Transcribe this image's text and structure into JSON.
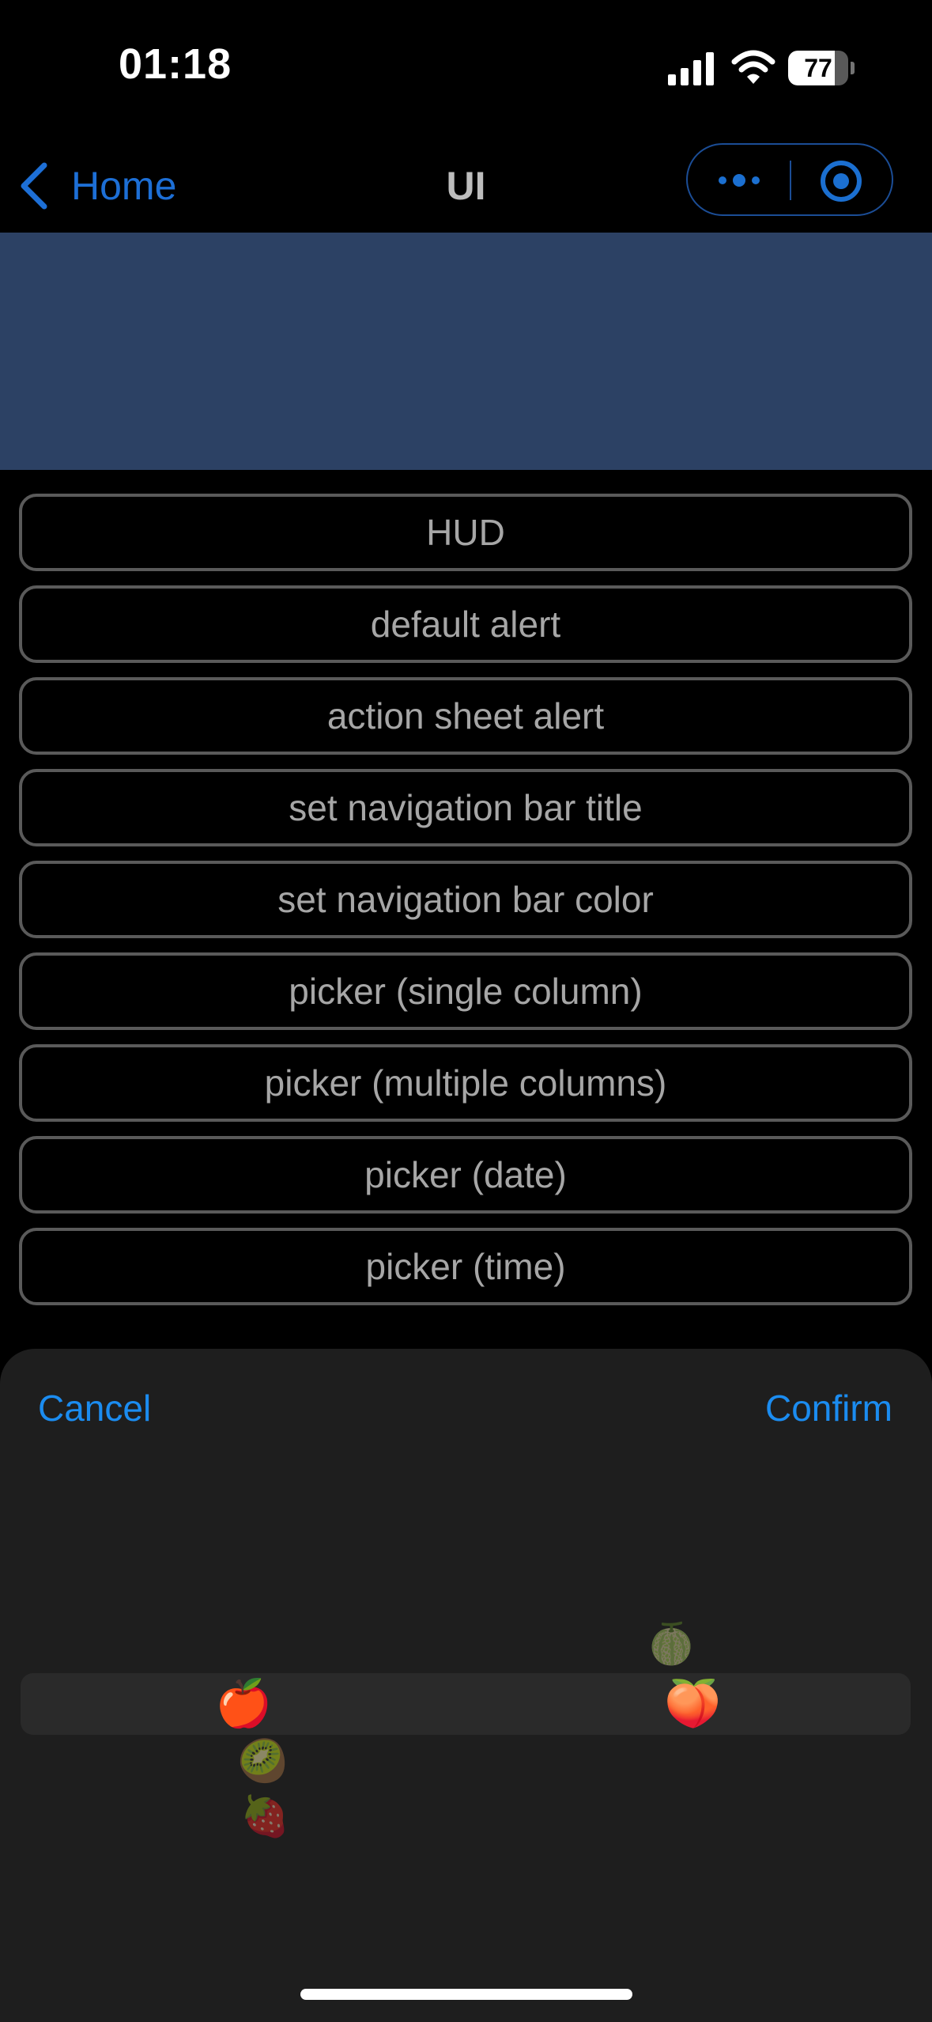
{
  "status_bar": {
    "time": "01:18",
    "battery_level": "77"
  },
  "nav": {
    "back_label": "Home",
    "title": "UI"
  },
  "buttons": [
    "HUD",
    "default alert",
    "action sheet alert",
    "set navigation bar title",
    "set navigation bar color",
    "picker (single column)",
    "picker (multiple columns)",
    "picker (date)",
    "picker (time)"
  ],
  "picker": {
    "cancel_label": "Cancel",
    "confirm_label": "Confirm",
    "column_1": [
      "🍎",
      "🥝",
      "🍓"
    ],
    "column_2": [
      "🍈",
      "🍑"
    ],
    "selected_column_1": "🍎",
    "selected_column_2": "🍑"
  },
  "colors": {
    "accent": "#1b8cf0",
    "banner": "#2c4164",
    "sheet_background": "#1e1e1e"
  }
}
